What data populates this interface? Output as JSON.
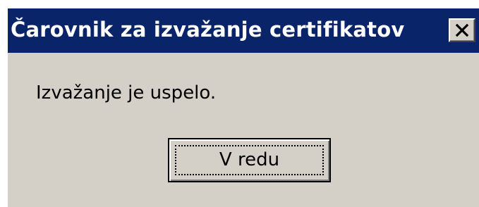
{
  "dialog": {
    "title": "Čarovnik za izvažanje certifikatov",
    "message": "Izvažanje je uspelo.",
    "ok_label": "V redu",
    "close_icon": "close-icon"
  },
  "colors": {
    "titlebar": "#0a246a",
    "title_text": "#ffffff",
    "face": "#d4d0c8"
  }
}
